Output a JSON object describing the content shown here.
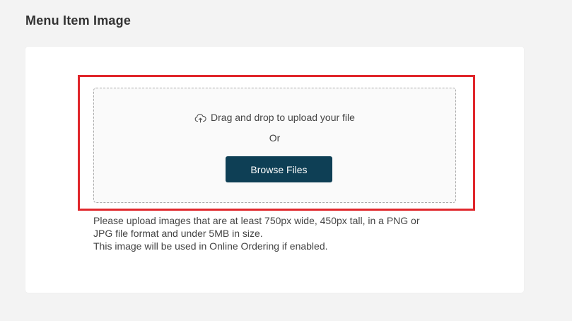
{
  "section": {
    "title": "Menu Item Image"
  },
  "upload": {
    "drag_text": "Drag and drop to upload your file",
    "or_text": "Or",
    "browse_label": "Browse Files",
    "icon": "cloud-upload-icon"
  },
  "help": {
    "line1": "Please upload images that are at least 750px wide, 450px tall, in a PNG or",
    "line2": "JPG file format and under 5MB in size.",
    "line3": "This image will be used in Online Ordering if enabled."
  },
  "colors": {
    "button_bg": "#0e3f55",
    "highlight": "#e0262b",
    "page_bg": "#f3f3f3"
  }
}
